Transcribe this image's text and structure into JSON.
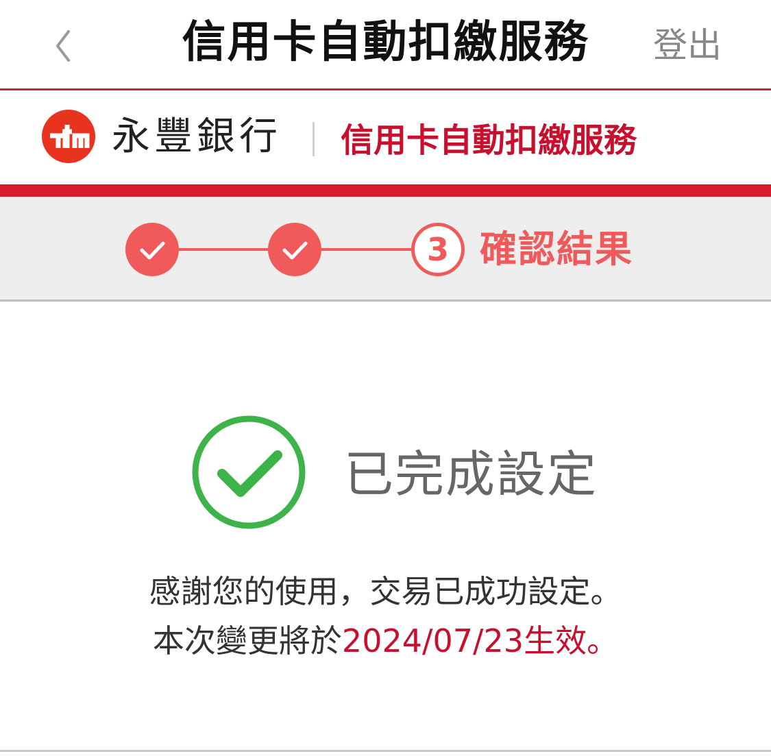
{
  "navbar": {
    "title": "信用卡自動扣繳服務",
    "logout_label": "登出",
    "back_icon": "chevron-left-icon"
  },
  "brand": {
    "logo_icon": "sinopac-logo-icon",
    "bank_name": "永豐銀行",
    "service_name": "信用卡自動扣繳服務",
    "accent_color": "#d71a2d"
  },
  "stepper": {
    "steps": [
      {
        "status": "done",
        "icon": "check-icon"
      },
      {
        "status": "done",
        "icon": "check-icon"
      },
      {
        "status": "current",
        "number": "3"
      }
    ],
    "current_label": "確認結果",
    "color": "#f05a5a"
  },
  "result": {
    "icon": "success-check-circle-icon",
    "icon_color": "#3db34a",
    "title": "已完成設定",
    "message_line1": "感謝您的使用，交易已成功設定。",
    "message_line2_prefix": "本次變更將於",
    "effective_date": "2024/07/23",
    "message_line2_suffix": "生效。"
  }
}
